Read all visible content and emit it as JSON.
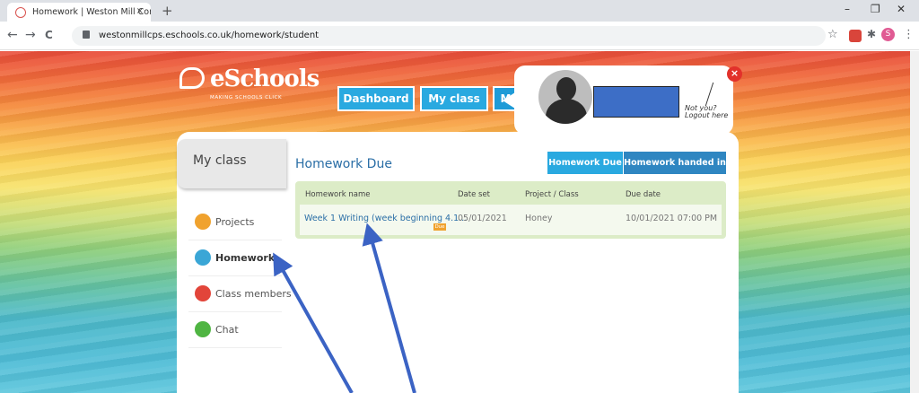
{
  "browser": {
    "tab_title": "Homework | Weston Mill Comm",
    "tab_close": "×",
    "new_tab": "+",
    "url": "westonmillcps.eschools.co.uk/homework/student",
    "controls": [
      "–",
      "❐",
      "✕"
    ],
    "nav": [
      "←",
      "→",
      "C"
    ],
    "ext_star": "☆",
    "ext_puzzle": "✱",
    "ext_menu": "⋮",
    "profile_initial": "S"
  },
  "logo": {
    "text": "eSchools",
    "tagline": "MAKING SCHOOLS CLICK"
  },
  "topnav": {
    "dashboard": "Dashboard",
    "myclass": "My class",
    "me": "Me"
  },
  "profile": {
    "not_you_line1": "Not you?",
    "not_you_line2": "Logout here",
    "logout_icon": "×"
  },
  "sidebar": {
    "heading": "My class",
    "items": [
      {
        "label": "Projects",
        "icon": "projects-icon",
        "color": "#f0a22e"
      },
      {
        "label": "Homework",
        "icon": "home-icon",
        "color": "#3aa6d6"
      },
      {
        "label": "Class members",
        "icon": "people-icon",
        "color": "#e2453a"
      },
      {
        "label": "Chat",
        "icon": "chat-icon",
        "color": "#4fb542"
      }
    ]
  },
  "main": {
    "title": "Homework Due",
    "tabs": {
      "due": "Homework Due",
      "handed_in": "Homework handed in"
    },
    "columns": [
      "Homework name",
      "Date set",
      "Project / Class",
      "Due date"
    ],
    "rows": [
      {
        "name": "Week 1 Writing (week beginning 4.1...",
        "badge": "Due",
        "date_set": "05/01/2021",
        "project": "Honey",
        "due_date": "10/01/2021 07:00 PM"
      }
    ]
  },
  "colors": {
    "accent_blue": "#29a9e0",
    "tab_dark": "#2f86c1",
    "annotation_arrow": "#3b63c4"
  }
}
